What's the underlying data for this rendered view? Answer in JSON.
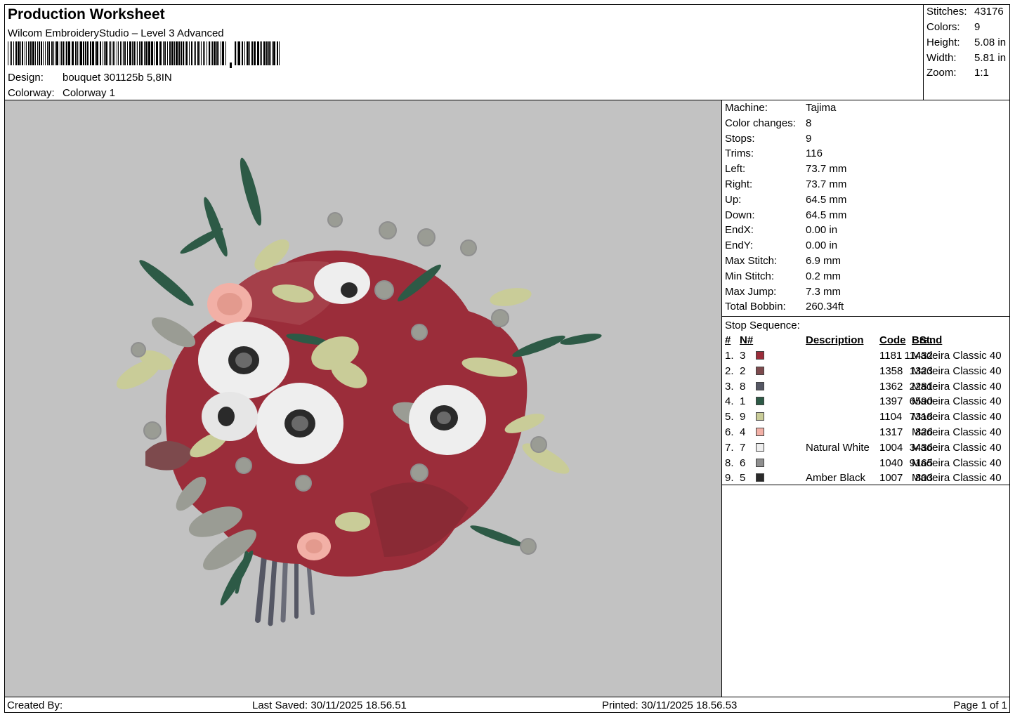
{
  "header": {
    "title": "Production Worksheet",
    "software": "Wilcom EmbroideryStudio – Level 3 Advanced",
    "design_label": "Design:",
    "design_value": "bouquet 301125b 5,8IN",
    "colorway_label": "Colorway:",
    "colorway_value": "Colorway 1"
  },
  "stats": [
    {
      "label": "Stitches:",
      "value": "43176"
    },
    {
      "label": "Colors:",
      "value": "9"
    },
    {
      "label": "Height:",
      "value": "5.08 in"
    },
    {
      "label": "Width:",
      "value": "5.81 in"
    },
    {
      "label": "Zoom:",
      "value": "1:1"
    }
  ],
  "machine_info": [
    {
      "label": "Machine:",
      "value": "Tajima"
    },
    {
      "label": "Color changes:",
      "value": "8"
    },
    {
      "label": "Stops:",
      "value": "9"
    },
    {
      "label": "Trims:",
      "value": "116"
    },
    {
      "label": "Left:",
      "value": "73.7 mm"
    },
    {
      "label": "Right:",
      "value": "73.7 mm"
    },
    {
      "label": "Up:",
      "value": "64.5 mm"
    },
    {
      "label": "Down:",
      "value": "64.5 mm"
    },
    {
      "label": "EndX:",
      "value": "0.00 in"
    },
    {
      "label": "EndY:",
      "value": "0.00 in"
    },
    {
      "label": "Max Stitch:",
      "value": "6.9 mm"
    },
    {
      "label": "Min Stitch:",
      "value": "0.2 mm"
    },
    {
      "label": "Max Jump:",
      "value": "7.3 mm"
    },
    {
      "label": "Total Bobbin:",
      "value": "260.34ft"
    }
  ],
  "stop_sequence": {
    "title": "Stop Sequence:",
    "headers": {
      "num": "#",
      "n": "N#",
      "st": "St.",
      "description": "Description",
      "code": "Code",
      "brand": "Brand"
    },
    "rows": [
      {
        "num": "1.",
        "n": "3",
        "color": "#9b2d3a",
        "st": "11432",
        "description": "",
        "code": "1181",
        "brand": "Madeira Classic 40"
      },
      {
        "num": "2.",
        "n": "2",
        "color": "#7d4a4d",
        "st": "1323",
        "description": "",
        "code": "1358",
        "brand": "Madeira Classic 40"
      },
      {
        "num": "3.",
        "n": "8",
        "color": "#555764",
        "st": "2281",
        "description": "",
        "code": "1362",
        "brand": "Madeira Classic 40"
      },
      {
        "num": "4.",
        "n": "1",
        "color": "#2d5a46",
        "st": "6590",
        "description": "",
        "code": "1397",
        "brand": "Madeira Classic 40"
      },
      {
        "num": "5.",
        "n": "9",
        "color": "#c9cc98",
        "st": "7318",
        "description": "",
        "code": "1104",
        "brand": "Madeira Classic 40"
      },
      {
        "num": "6.",
        "n": "4",
        "color": "#f2b0a6",
        "st": "826",
        "description": "",
        "code": "1317",
        "brand": "Madeira Classic 40"
      },
      {
        "num": "7.",
        "n": "7",
        "color": "#eeeeee",
        "st": "3436",
        "description": "Natural White",
        "code": "1004",
        "brand": "Madeira Classic 40"
      },
      {
        "num": "8.",
        "n": "6",
        "color": "#8f8f8f",
        "st": "9165",
        "description": "",
        "code": "1040",
        "brand": "Madeira Classic 40"
      },
      {
        "num": "9.",
        "n": "5",
        "color": "#2a2a2a",
        "st": "803",
        "description": "Amber Black",
        "code": "1007",
        "brand": "Madeira Classic 40"
      }
    ]
  },
  "footer": {
    "created_by": "Created By:",
    "last_saved": "Last Saved: 30/11/2025 18.56.51",
    "printed": "Printed: 30/11/2025 18.56.53",
    "page": "Page 1 of 1"
  },
  "canvas": {
    "background": "#c2c2c2"
  }
}
